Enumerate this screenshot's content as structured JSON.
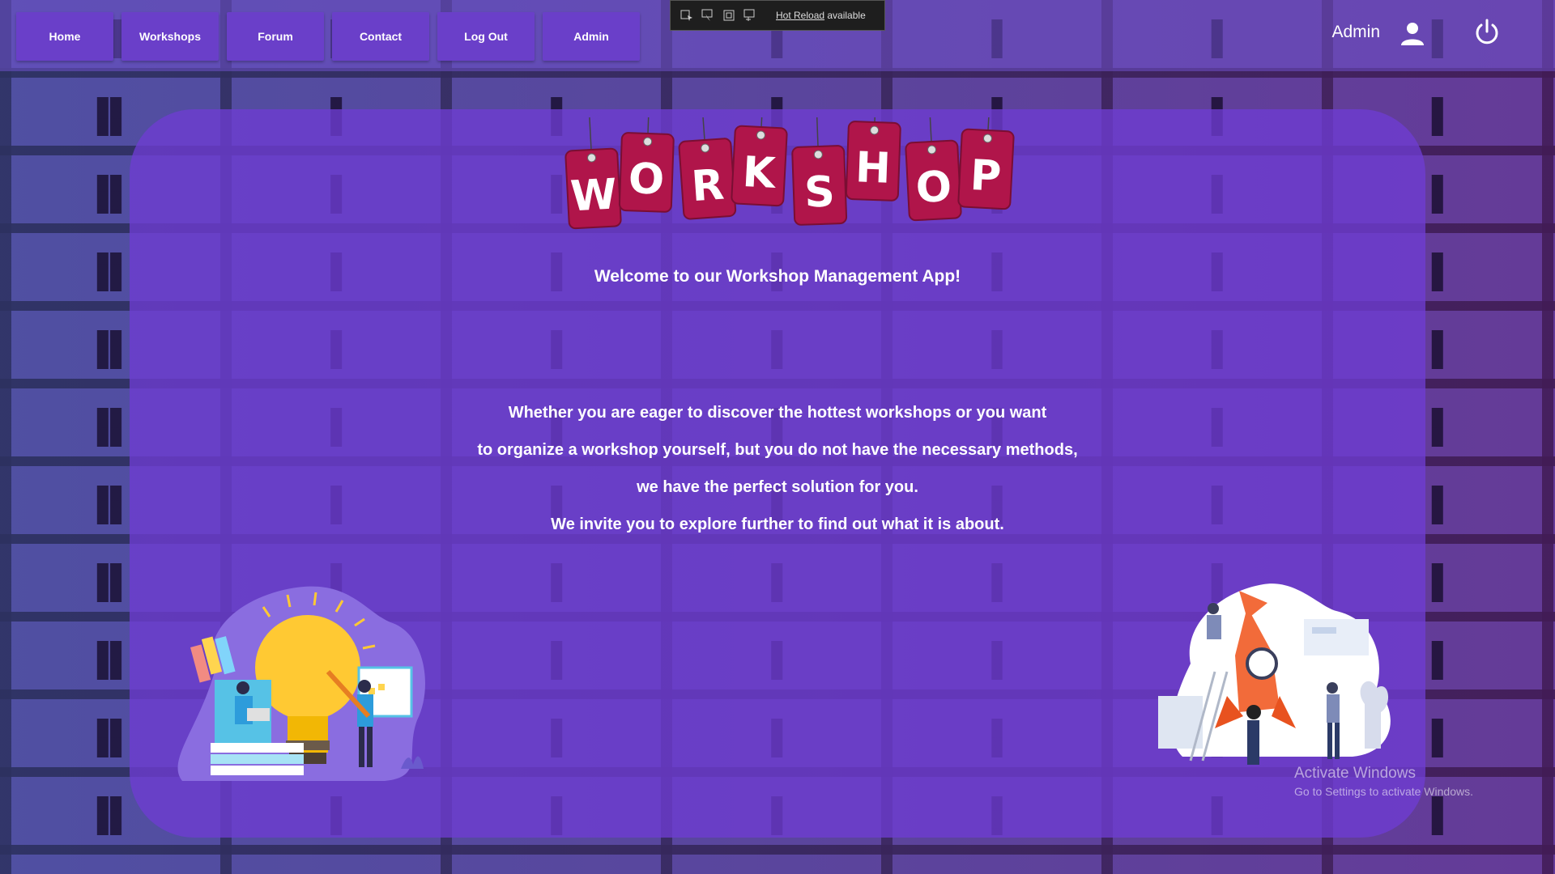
{
  "nav": {
    "items": [
      {
        "label": "Home"
      },
      {
        "label": "Workshops"
      },
      {
        "label": "Forum"
      },
      {
        "label": "Contact"
      },
      {
        "label": "Log Out"
      },
      {
        "label": "Admin"
      }
    ]
  },
  "user": {
    "name": "Admin",
    "icons": [
      "user-icon",
      "power-icon"
    ]
  },
  "hot_reload": {
    "link": "Hot Reload",
    "suffix": " available"
  },
  "logo_letters": [
    "W",
    "O",
    "R",
    "K",
    "S",
    "H",
    "O",
    "P"
  ],
  "welcome": "Welcome to our Workshop Management App!",
  "paragraph": [
    "Whether you are eager to discover the hottest workshops or you want",
    "to organize a workshop yourself, but you do not have the necessary methods,",
    "we have the perfect solution for you.",
    "We invite you to explore further to find out what it is about."
  ],
  "watermark": {
    "title": "Activate Windows",
    "subtitle": "Go to Settings to activate Windows."
  },
  "colors": {
    "nav_button": "#6a3fc9",
    "panel": "#6e3cd2",
    "tag": "#b0154a"
  }
}
